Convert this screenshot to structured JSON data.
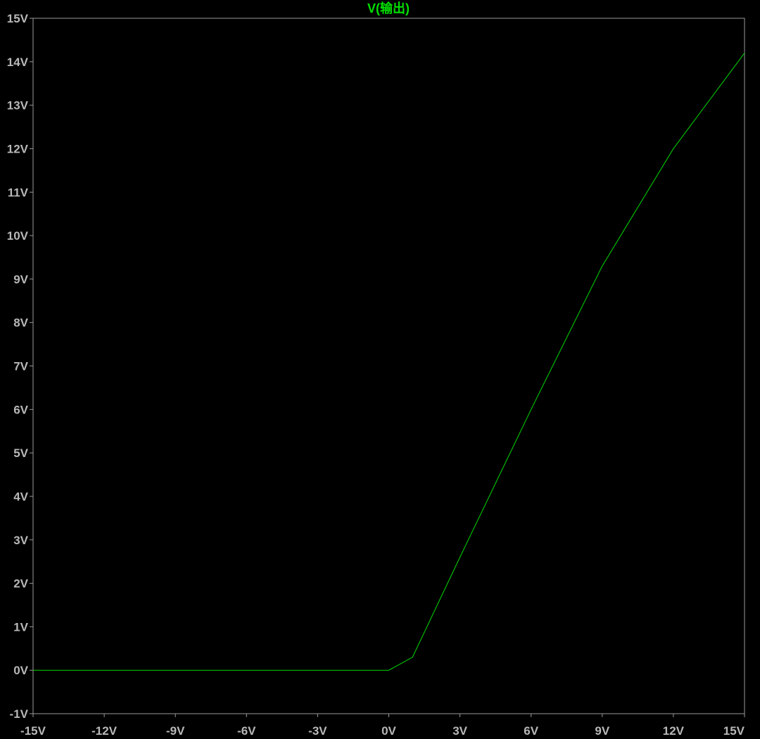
{
  "colors": {
    "background": "#000000",
    "axis": "#9a9a9a",
    "tick_label": "#b8b8b8",
    "trace": "#00d800",
    "title": "#00e000"
  },
  "chart_data": {
    "type": "line",
    "title": "V(输出)",
    "xlabel": "",
    "ylabel": "",
    "xlim": [
      -15,
      15
    ],
    "ylim": [
      -1,
      15
    ],
    "grid": false,
    "x_ticks": [
      -15,
      -12,
      -9,
      -6,
      -3,
      0,
      3,
      6,
      9,
      12,
      15
    ],
    "x_tick_labels": [
      "-15V",
      "-12V",
      "-9V",
      "-6V",
      "-3V",
      "0V",
      "3V",
      "6V",
      "9V",
      "12V",
      "15V"
    ],
    "y_ticks": [
      -1,
      0,
      1,
      2,
      3,
      4,
      5,
      6,
      7,
      8,
      9,
      10,
      11,
      12,
      13,
      14,
      15
    ],
    "y_tick_labels": [
      "-1V",
      "0V",
      "1V",
      "2V",
      "3V",
      "4V",
      "5V",
      "6V",
      "7V",
      "8V",
      "9V",
      "10V",
      "11V",
      "12V",
      "13V",
      "14V",
      "15V"
    ],
    "series": [
      {
        "name": "V(输出)",
        "color": "#00d800",
        "x": [
          -15,
          -12,
          -9,
          -6,
          -3,
          0,
          1,
          3,
          6,
          9,
          12,
          15
        ],
        "y": [
          0,
          0,
          0,
          0,
          0,
          0,
          0.3,
          2.6,
          6.0,
          9.3,
          12.0,
          14.2
        ]
      }
    ]
  }
}
